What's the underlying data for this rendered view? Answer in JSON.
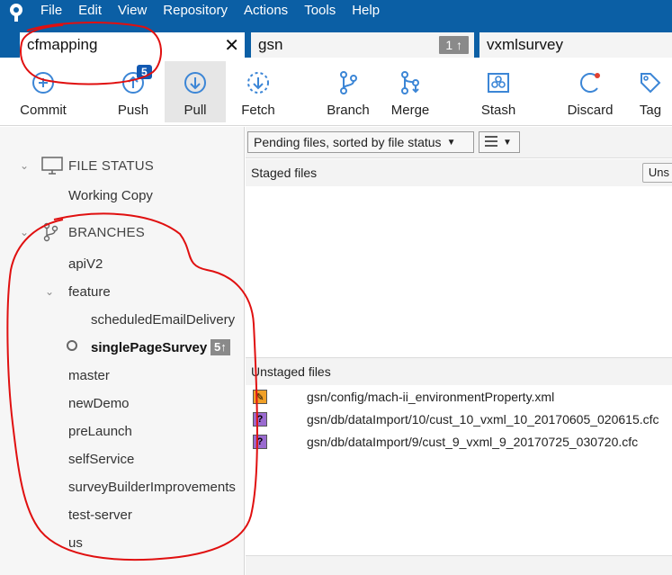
{
  "menubar": {
    "items": [
      "File",
      "Edit",
      "View",
      "Repository",
      "Actions",
      "Tools",
      "Help"
    ]
  },
  "tabs": [
    {
      "label": "cfmapping",
      "close": "✕"
    },
    {
      "label": "gsn",
      "badge": "1 ↑"
    },
    {
      "label": "vxmlsurvey"
    }
  ],
  "toolbar": {
    "commit": "Commit",
    "push": "Push",
    "push_badge": "5",
    "pull": "Pull",
    "fetch": "Fetch",
    "branch": "Branch",
    "merge": "Merge",
    "stash": "Stash",
    "discard": "Discard",
    "tag": "Tag"
  },
  "sidebar": {
    "file_status": {
      "header": "FILE STATUS",
      "items": [
        "Working Copy"
      ]
    },
    "branches": {
      "header": "BRANCHES",
      "items": [
        "apiV2",
        "feature",
        "scheduledEmailDelivery",
        "singlePageSurvey",
        "master",
        "newDemo",
        "preLaunch",
        "selfService",
        "surveyBuilderImprovements",
        "test-server",
        "us"
      ],
      "current_badge": "5↑"
    }
  },
  "main": {
    "filter_select": "Pending files, sorted by file status",
    "staged_header": "Staged files",
    "unstage_button": "Uns",
    "unstaged_header": "Unstaged files",
    "unstaged_files": [
      {
        "path": "gsn/config/mach-ii_environmentProperty.xml",
        "status": "modified",
        "status_glyph": "✎"
      },
      {
        "path": "gsn/db/dataImport/10/cust_10_vxml_10_20170605_020615.cfc",
        "status": "untracked",
        "status_glyph": "?"
      },
      {
        "path": "gsn/db/dataImport/9/cust_9_vxml_9_20170725_030720.cfc",
        "status": "untracked",
        "status_glyph": "?"
      }
    ]
  },
  "colors": {
    "menubar_bg": "#0b5fa5",
    "annotation": "#e01010",
    "badge_blue": "#1159b2",
    "modified": "#f0a028",
    "untracked": "#9a6bd0"
  }
}
